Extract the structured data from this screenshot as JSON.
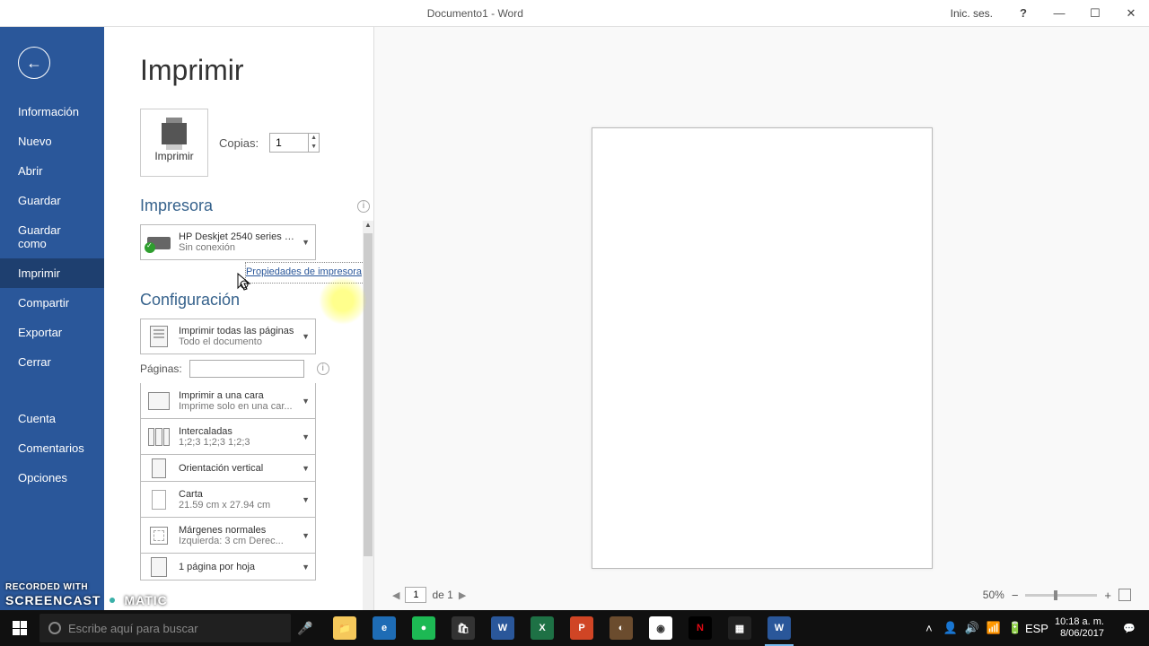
{
  "titlebar": {
    "title": "Documento1 - Word",
    "signin": "Inic. ses.",
    "help": "?",
    "minimize": "—",
    "maximize": "☐",
    "close": "✕"
  },
  "sidebar": {
    "items": [
      "Información",
      "Nuevo",
      "Abrir",
      "Guardar",
      "Guardar como",
      "Imprimir",
      "Compartir",
      "Exportar",
      "Cerrar"
    ],
    "bottom": [
      "Cuenta",
      "Comentarios",
      "Opciones"
    ],
    "active_index": 5
  },
  "print": {
    "title": "Imprimir",
    "print_button": "Imprimir",
    "copies_label": "Copias:",
    "copies_value": "1",
    "printer_section": "Impresora",
    "printer_name": "HP Deskjet 2540 series (R...",
    "printer_status": "Sin conexión",
    "printer_props": "Propiedades de impresora",
    "config_section": "Configuración",
    "config": {
      "scope_line1": "Imprimir todas las páginas",
      "scope_line2": "Todo el documento",
      "pages_label": "Páginas:",
      "sides_line1": "Imprimir a una cara",
      "sides_line2": "Imprime solo en una car...",
      "collate_line1": "Intercaladas",
      "collate_line2": "1;2;3    1;2;3    1;2;3",
      "orientation": "Orientación vertical",
      "paper_line1": "Carta",
      "paper_line2": "21.59 cm x 27.94 cm",
      "margins_line1": "Márgenes normales",
      "margins_line2": "Izquierda:  3 cm    Derec...",
      "per_sheet": "1 página por hoja"
    }
  },
  "preview": {
    "page_current": "1",
    "page_total": "de 1",
    "zoom": "50%"
  },
  "taskbar": {
    "search_placeholder": "Escribe aquí para buscar",
    "lang": "ESP",
    "time": "10:18 a. m.",
    "date": "8/06/2017"
  },
  "watermark": {
    "line1": "RECORDED WITH",
    "line2": "SCREENCAST    MATIC"
  }
}
